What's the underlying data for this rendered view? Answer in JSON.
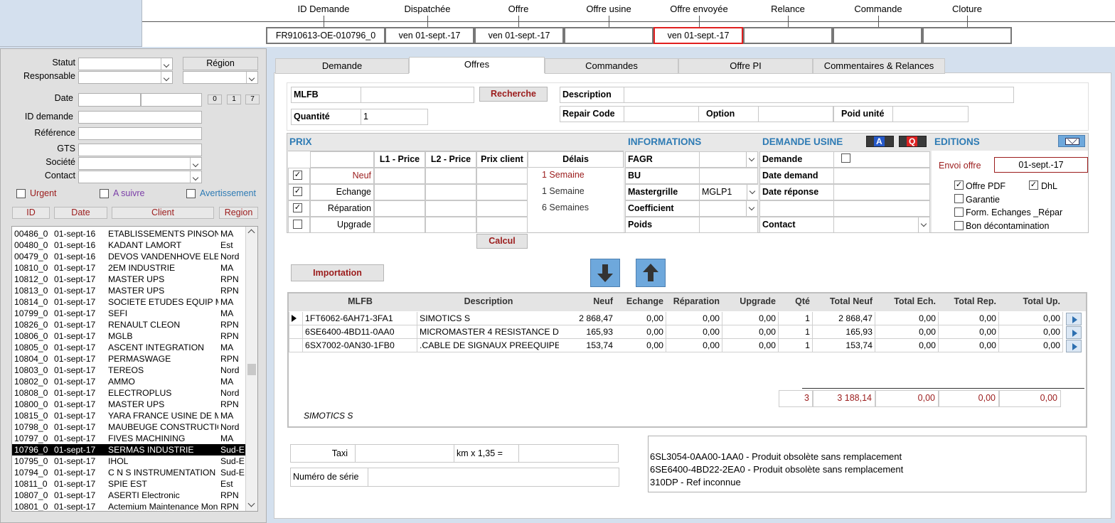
{
  "timeline": {
    "labels": [
      "ID Demande",
      "Dispatchée",
      "Offre",
      "Offre usine",
      "Offre envoyée",
      "Relance",
      "Commande",
      "Cloture"
    ],
    "values": [
      "FR910613-OE-010796_0",
      "ven 01-sept.-17",
      "ven 01-sept.-17",
      "",
      "ven 01-sept.-17",
      "",
      "",
      ""
    ]
  },
  "filters": {
    "statut_label": "Statut",
    "responsable_label": "Responsable",
    "region_button": "Région",
    "date_label": "Date",
    "date_btn_0": "0",
    "date_btn_1": "1",
    "date_btn_7": "7",
    "id_demande_label": "ID demande",
    "reference_label": "Référence",
    "gts_label": "GTS",
    "societe_label": "Société",
    "contact_label": "Contact",
    "urgent_label": "Urgent",
    "a_suivre_label": "A suivre",
    "avertissement_label": "Avertissement"
  },
  "list": {
    "headers": [
      "ID",
      "Date",
      "Client",
      "Region"
    ],
    "rows": [
      [
        "00486_0",
        "01-sept-16",
        "ETABLISSEMENTS PINSON",
        "MA"
      ],
      [
        "00480_0",
        "01-sept-16",
        "KADANT LAMORT",
        "Est"
      ],
      [
        "00479_0",
        "01-sept-16",
        "DEVOS VANDENHOVE ELE",
        "Nord"
      ],
      [
        "10810_0",
        "01-sept-17",
        "2EM INDUSTRIE",
        "MA"
      ],
      [
        "10812_0",
        "01-sept-17",
        "MASTER UPS",
        "RPN"
      ],
      [
        "10813_0",
        "01-sept-17",
        "MASTER UPS",
        "RPN"
      ],
      [
        "10814_0",
        "01-sept-17",
        "SOCIETE ETUDES EQUIP M",
        "MA"
      ],
      [
        "10799_0",
        "01-sept-17",
        "SEFI",
        "MA"
      ],
      [
        "10826_0",
        "01-sept-17",
        "RENAULT CLEON",
        "RPN"
      ],
      [
        "10806_0",
        "01-sept-17",
        "MGLB",
        "RPN"
      ],
      [
        "10805_0",
        "01-sept-17",
        "ASCENT INTEGRATION",
        "MA"
      ],
      [
        "10804_0",
        "01-sept-17",
        "PERMASWAGE",
        "RPN"
      ],
      [
        "10803_0",
        "01-sept-17",
        "TEREOS",
        "Nord"
      ],
      [
        "10802_0",
        "01-sept-17",
        "AMMO",
        "MA"
      ],
      [
        "10808_0",
        "01-sept-17",
        "ELECTROPLUS",
        "Nord"
      ],
      [
        "10800_0",
        "01-sept-17",
        "MASTER UPS",
        "RPN"
      ],
      [
        "10815_0",
        "01-sept-17",
        "YARA FRANCE USINE DE M",
        "MA"
      ],
      [
        "10798_0",
        "01-sept-17",
        "MAUBEUGE CONSTRUCTIO",
        "Nord"
      ],
      [
        "10797_0",
        "01-sept-17",
        "FIVES MACHINING",
        "MA"
      ],
      [
        "10796_0",
        "01-sept-17",
        "SERMAS INDUSTRIE",
        "Sud-E"
      ],
      [
        "10795_0",
        "01-sept-17",
        "IHOL",
        "Sud-E"
      ],
      [
        "10794_0",
        "01-sept-17",
        "C N S INSTRUMENTATION",
        "Sud-E"
      ],
      [
        "10811_0",
        "01-sept-17",
        "SPIE EST",
        "Est"
      ],
      [
        "10807_0",
        "01-sept-17",
        "ASERTI Electronic",
        "RPN"
      ],
      [
        "10801_0",
        "01-sept-17",
        "Actemium Maintenance Mon",
        "RPN"
      ]
    ],
    "selected_index": 19
  },
  "tabs": [
    "Demande",
    "Offres",
    "Commandes",
    "Offre PI",
    "Commentaires & Relances"
  ],
  "form": {
    "mlfb_label": "MLFB",
    "recherche_button": "Recherche",
    "description_label": "Description",
    "quantite_label": "Quantité",
    "quantite_value": "1",
    "repair_code_label": "Repair Code",
    "option_label": "Option",
    "poid_unite_label": "Poid unité"
  },
  "prix": {
    "title": "PRIX",
    "headers": [
      "L1 - Price",
      "L2 - Price",
      "Prix client",
      "Délais"
    ],
    "rows": [
      {
        "label": "Neuf",
        "checked": true,
        "delai": "1 Semaine"
      },
      {
        "label": "Echange",
        "checked": true,
        "delai": "1 Semaine"
      },
      {
        "label": "Réparation",
        "checked": true,
        "delai": "6 Semaines"
      },
      {
        "label": "Upgrade",
        "checked": false,
        "delai": ""
      }
    ],
    "calcul_button": "Calcul"
  },
  "informations": {
    "title": "INFORMATIONS",
    "fagr_label": "FAGR",
    "bu_label": "BU",
    "mastergrille_label": "Mastergrille",
    "mastergrille_value": "MGLP1",
    "coefficient_label": "Coefficient",
    "poids_label": "Poids"
  },
  "demande_usine": {
    "title": "DEMANDE USINE",
    "demande_label": "Demande",
    "date_demand_label": "Date demand",
    "date_reponse_label": "Date réponse",
    "contact_label": "Contact",
    "btn_a": "A",
    "btn_q": "Q"
  },
  "editions": {
    "title": "EDITIONS",
    "envoi_offre_label": "Envoi offre",
    "envoi_offre_value": "01-sept.-17",
    "offre_pdf_label": "Offre PDF",
    "dhl_label": "DhL",
    "garantie_label": "Garantie",
    "form_echanges_label": "Form. Echanges _Répar",
    "bon_decontamination_label": "Bon décontamination"
  },
  "importation_button": "Importation",
  "grid": {
    "headers": [
      "MLFB",
      "Description",
      "Neuf",
      "Echange",
      "Réparation",
      "Upgrade",
      "Qté",
      "Total Neuf",
      "Total Ech.",
      "Total Rep.",
      "Total Up."
    ],
    "rows": [
      [
        "1FT6062-6AH71-3FA1",
        "SIMOTICS S",
        "2 868,47",
        "0,00",
        "0,00",
        "0,00",
        "1",
        "2 868,47",
        "0,00",
        "0,00",
        "0,00"
      ],
      [
        "6SE6400-4BD11-0AA0",
        "MICROMASTER 4 RESISTANCE DE",
        "165,93",
        "0,00",
        "0,00",
        "0,00",
        "1",
        "165,93",
        "0,00",
        "0,00",
        "0,00"
      ],
      [
        "6SX7002-0AN30-1FB0",
        ".CABLE DE SIGNAUX PREEQUIPE 1",
        "153,74",
        "0,00",
        "0,00",
        "0,00",
        "1",
        "153,74",
        "0,00",
        "0,00",
        "0,00"
      ]
    ],
    "totals": [
      "3",
      "3 188,14",
      "0,00",
      "0,00",
      "0,00"
    ],
    "footer_text": "SIMOTICS S"
  },
  "taxi": {
    "label": "Taxi",
    "km_label": "km   x 1,35 =",
    "numero_serie_label": "Numéro de série"
  },
  "notes": [
    "6SL3054-0AA00-1AA0 - Produit obsolète sans remplacement",
    " 6SE6400-4BD22-2EA0 - Produit obsolète sans remplacement",
    "310DP  - Ref inconnue"
  ],
  "colors": {
    "accent_red": "#9b1c1c",
    "section_blue": "#2e7bb4",
    "highlight_border": "#e02020"
  }
}
